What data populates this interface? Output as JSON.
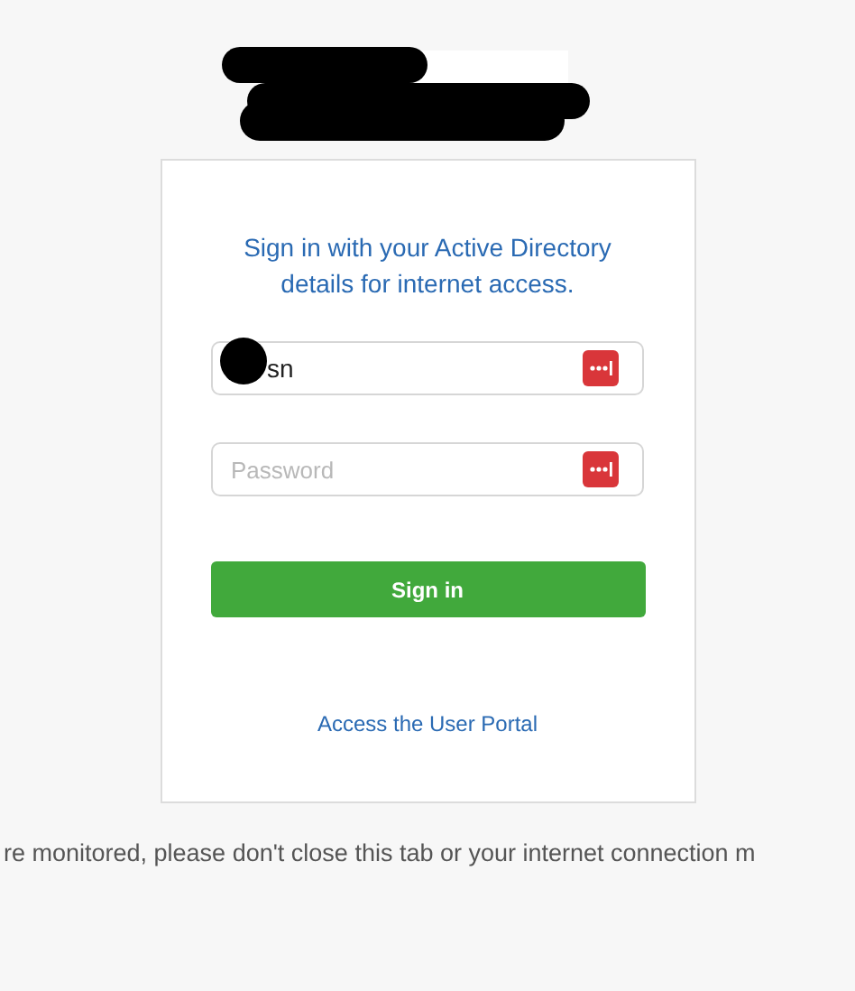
{
  "login_card": {
    "heading": "Sign in with your Active Directory details for internet access.",
    "username_field": {
      "value": "sn"
    },
    "password_field": {
      "placeholder": "Password"
    },
    "sign_in_button": "Sign in",
    "portal_link": "Access the User Portal"
  },
  "footer_notice": "re monitored, please don't close this tab or your internet connection m"
}
